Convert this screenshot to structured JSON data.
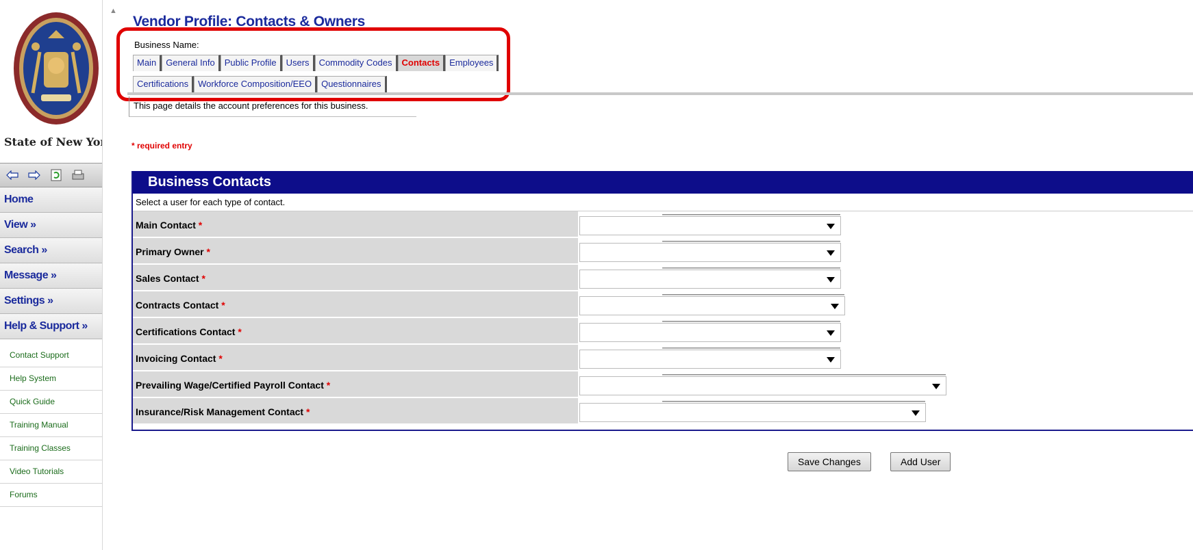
{
  "sidebar": {
    "state_name": "State of New York",
    "toolbar": [
      {
        "icon": "back-arrow-icon"
      },
      {
        "icon": "forward-arrow-icon"
      },
      {
        "icon": "refresh-icon"
      },
      {
        "icon": "print-icon"
      }
    ],
    "nav": [
      "Home",
      "View »",
      "Search »",
      "Message »",
      "Settings »",
      "Help & Support »"
    ],
    "help_links": [
      "Contact Support",
      "Help System",
      "Quick Guide",
      "Training Manual",
      "Training Classes",
      "Video Tutorials",
      "Forums"
    ]
  },
  "main": {
    "title": "Vendor Profile: Contacts & Owners",
    "business_name_label": "Business Name:",
    "tabs_row1": [
      "Main",
      "General Info",
      "Public Profile",
      "Users",
      "Commodity Codes",
      "Contacts",
      "Employees"
    ],
    "tabs_row2": [
      "Certifications",
      "Workforce Composition/EEO",
      "Questionnaires"
    ],
    "active_tab": "Contacts",
    "description": "This page details the account preferences for this business.",
    "required_note": "* required entry",
    "panel": {
      "title": "Business Contacts",
      "instruction": "Select a user for each type of contact.",
      "fields": [
        {
          "label": "Main Contact",
          "required": "*",
          "value": ""
        },
        {
          "label": "Primary Owner",
          "required": "*",
          "value": ""
        },
        {
          "label": "Sales Contact",
          "required": "*",
          "value": ""
        },
        {
          "label": "Contracts Contact",
          "required": "*",
          "value": ""
        },
        {
          "label": "Certifications Contact",
          "required": "*",
          "value": ""
        },
        {
          "label": "Invoicing Contact",
          "required": "*",
          "value": ""
        },
        {
          "label": "Prevailing Wage/Certified Payroll Contact",
          "required": "*",
          "value": ""
        },
        {
          "label": "Insurance/Risk Management Contact",
          "required": "*",
          "value": ""
        }
      ]
    },
    "buttons": {
      "save": "Save Changes",
      "add_user": "Add User"
    }
  },
  "colors": {
    "nav_blue": "#1a2a9c",
    "header_navy": "#0d0d8a",
    "required_red": "#e00000",
    "help_green": "#1a6b1a",
    "highlight_red": "#e00000"
  }
}
